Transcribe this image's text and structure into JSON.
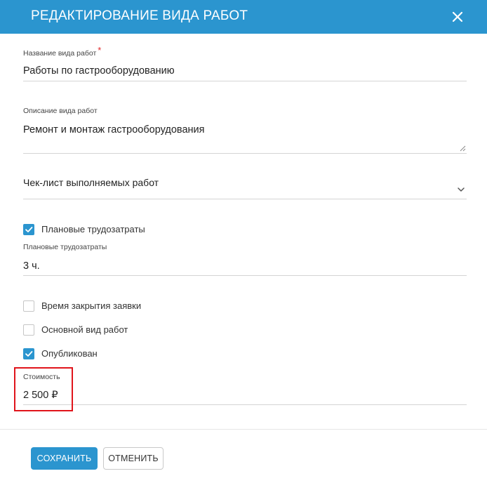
{
  "header": {
    "title": "РЕДАКТИРОВАНИЕ ВИДА РАБОТ"
  },
  "form": {
    "name": {
      "label": "Название вида работ",
      "required_mark": "*",
      "value": "Работы по гастрооборудованию"
    },
    "description": {
      "label": "Описание вида работ",
      "value": "Ремонт и монтаж гастрооборудования"
    },
    "checklist": {
      "placeholder": "Чек-лист выполняемых работ"
    },
    "planned_labor_toggle": {
      "label": "Плановые трудозатраты",
      "checked": true
    },
    "planned_labor": {
      "label": "Плановые трудозатраты",
      "value": "3 ч."
    },
    "closing_time": {
      "label": "Время закрытия заявки",
      "checked": false
    },
    "main_type": {
      "label": "Основной вид работ",
      "checked": false
    },
    "published": {
      "label": "Опубликован",
      "checked": true
    },
    "cost": {
      "label": "Стоимость",
      "value": "2 500 ₽"
    }
  },
  "footer": {
    "save_label": "СОХРАНИТЬ",
    "cancel_label": "ОТМЕНИТЬ"
  },
  "colors": {
    "accent": "#2b95cf",
    "required": "#e0292b",
    "highlight": "#e0141b"
  }
}
